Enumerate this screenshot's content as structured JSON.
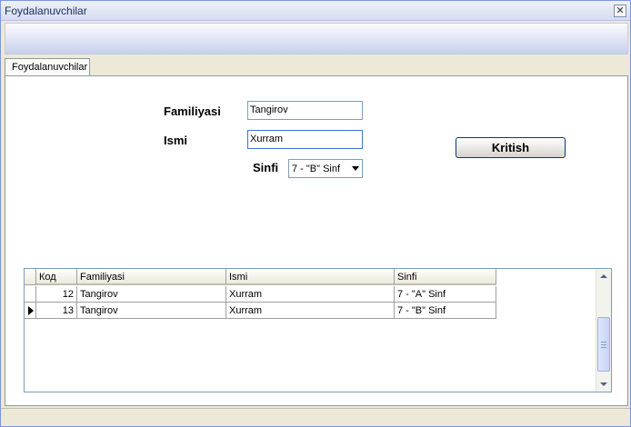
{
  "window": {
    "title": "Foydalanuvchilar"
  },
  "tabs": [
    {
      "label": "Foydalanuvchilar"
    }
  ],
  "form": {
    "familiyasi_label": "Familiyasi",
    "familiyasi_value": "Tangirov",
    "ismi_label": "Ismi",
    "ismi_value": "Xurram",
    "sinfi_label": "Sinfi",
    "sinfi_value": "7 - \"B\" Sinf",
    "submit_label": "Kritish"
  },
  "grid": {
    "headers": [
      "Код",
      "Familiyasi",
      "Ismi",
      "Sinfi"
    ],
    "rows": [
      {
        "kod": "12",
        "familiyasi": "Tangirov",
        "ismi": "Xurram",
        "sinfi": "7 - \"A\" Sinf"
      },
      {
        "kod": "13",
        "familiyasi": "Tangirov",
        "ismi": "Xurram",
        "sinfi": "7 - \"B\" Sinf"
      }
    ],
    "current_row_index": 1
  },
  "icons": {
    "close": "close-icon",
    "row_indicator": "current-row-arrow-icon",
    "scroll_up": "scroll-up-arrow-icon",
    "scroll_down": "scroll-down-arrow-icon"
  }
}
